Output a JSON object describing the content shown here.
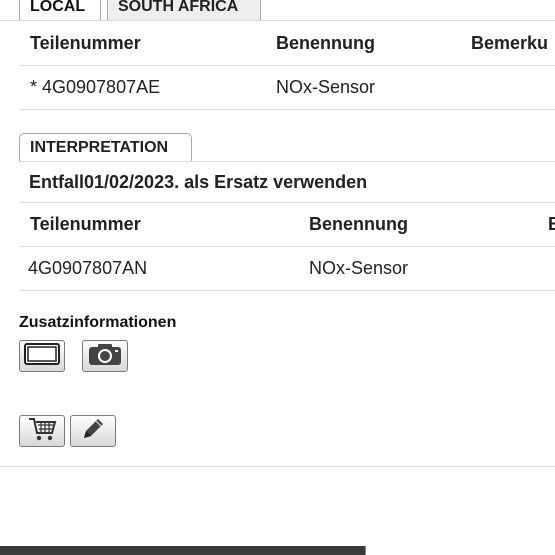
{
  "tabs": [
    {
      "label": "LOCAL",
      "active": true
    },
    {
      "label": "SOUTH AFRICA",
      "active": false
    }
  ],
  "table1": {
    "headers": [
      "Teilenummer",
      "Benennung",
      "Bemerku"
    ],
    "rows": [
      {
        "part_number": "* 4G0907807AE",
        "name": "NOx-Sensor"
      }
    ]
  },
  "interpretation": {
    "tab_label": "INTERPRETATION",
    "note": "Entfall01/02/2023. als Ersatz verwenden",
    "headers": [
      "Teilenummer",
      "Benennung",
      "B"
    ],
    "rows": [
      {
        "part_number": "4G0907807AN",
        "name": "NOx-Sensor"
      }
    ]
  },
  "additional": {
    "label": "Zusatzinformationen",
    "icons": [
      "frame-icon",
      "camera-icon"
    ]
  },
  "actions": {
    "icons": [
      "cart-icon",
      "pencil-icon"
    ]
  }
}
